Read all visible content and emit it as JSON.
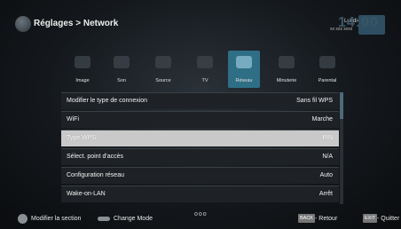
{
  "header": {
    "title": "Réglages > Network",
    "day": "Lundi",
    "date": "xx xxx xxxx",
    "clock": "14:00"
  },
  "tabs": [
    {
      "label": "Image",
      "icon": "image-icon"
    },
    {
      "label": "Son",
      "icon": "sound-icon"
    },
    {
      "label": "Source",
      "icon": "source-icon"
    },
    {
      "label": "TV",
      "icon": "tv-icon"
    },
    {
      "label": "Réseau",
      "icon": "network-icon",
      "active": true
    },
    {
      "label": "Minuterie",
      "icon": "timer-icon"
    },
    {
      "label": "Parental",
      "icon": "parental-icon"
    }
  ],
  "menu": [
    {
      "label": "Modifier le type de connexion",
      "value": "Sans fil WPS"
    },
    {
      "label": "WiFi",
      "value": "Marche"
    },
    {
      "label": "Type WPS",
      "value": "PIN",
      "selected": true
    },
    {
      "label": "Sélect. point d'accès",
      "value": "N/A"
    },
    {
      "label": "Configuration réseau",
      "value": "Auto"
    },
    {
      "label": "Wake-on-LAN",
      "value": "Arrêt"
    }
  ],
  "footer": {
    "modify_section": "Modifier la section",
    "change_mode": "Change Mode",
    "dots": "ooo",
    "back_key": "BACK",
    "back_label": "- Retour",
    "exit_key": "EXIT",
    "exit_label": "- Quitter"
  },
  "colors": {
    "accent": "#2e6f86",
    "selected_row": "#c9c9c9",
    "row_bg": "#1e2226"
  }
}
